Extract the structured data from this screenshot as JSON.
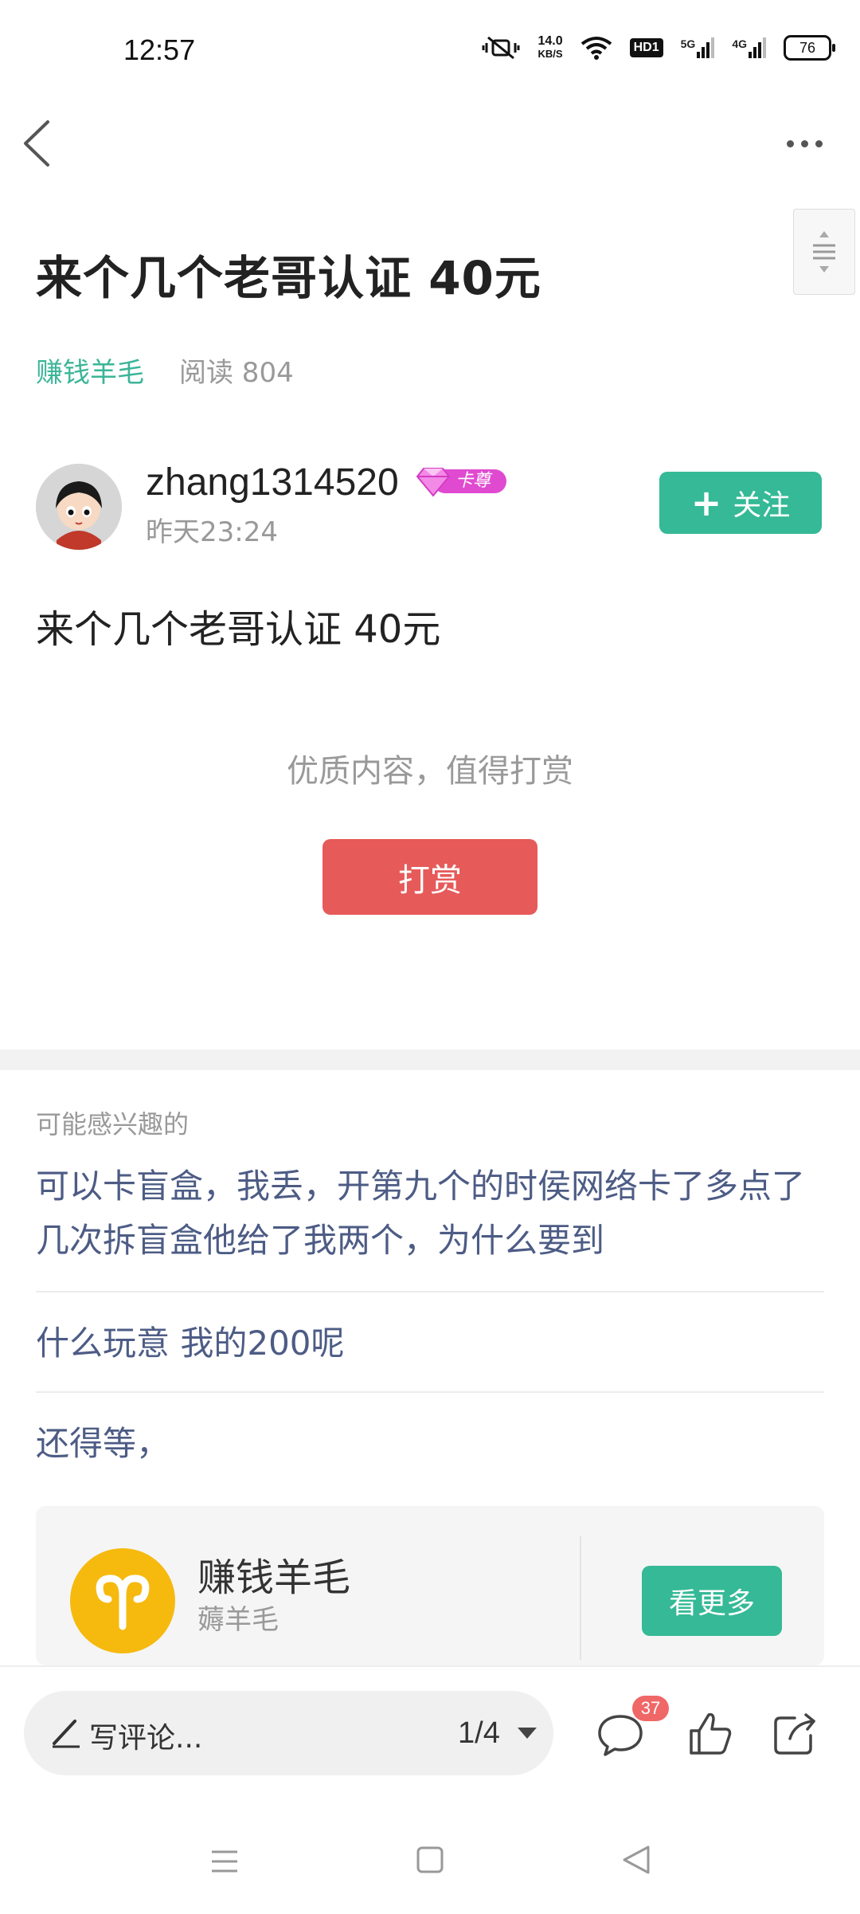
{
  "status_bar": {
    "time": "12:57",
    "net_speed_value": "14.0",
    "net_speed_unit": "KB/S",
    "hd_label": "HD1",
    "signal_1_label": "5G",
    "signal_2_label": "4G",
    "battery": "76"
  },
  "post": {
    "title": "来个几个老哥认证 40元",
    "category": "赚钱羊毛",
    "read_count": "阅读 804",
    "author": "zhang1314520",
    "vip_badge": "卡尊",
    "time": "昨天23:24",
    "follow_label": "关注",
    "body": "来个几个老哥认证 40元",
    "reward_hint": "优质内容，值得打赏",
    "reward_button": "打赏"
  },
  "recommendations": {
    "label": "可能感兴趣的",
    "items": [
      "可以卡盲盒，我丢，开第九个的时侯网络卡了多点了几次拆盲盒他给了我两个，为什么要到",
      "什么玩意 我的200呢",
      "还得等，"
    ]
  },
  "circle_card": {
    "name": "赚钱羊毛",
    "subtitle": "薅羊毛",
    "see_more": "看更多"
  },
  "bottom_bar": {
    "comment_placeholder": "写评论...",
    "page_indicator": "1/4",
    "comment_count": "37"
  },
  "colors": {
    "accent": "#35b996",
    "category_text": "#3bb598",
    "reward": "#e65a5a",
    "link_text": "#4d5c85",
    "badge": "#f06767",
    "circle_logo": "#f6b90e"
  }
}
